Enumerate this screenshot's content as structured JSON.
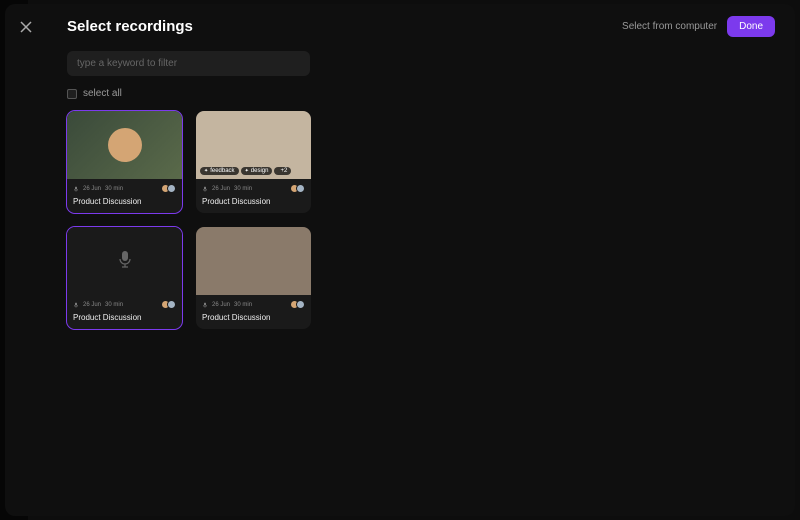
{
  "modal": {
    "title": "Select recordings",
    "select_from_computer": "Select from computer",
    "done": "Done",
    "search_placeholder": "type a keyword to filter",
    "select_all": "select all"
  },
  "recordings": [
    {
      "date": "26 Jun",
      "duration": "30 min",
      "title": "Product Discussion",
      "selected": true,
      "thumb_class": "t1",
      "tags": []
    },
    {
      "date": "26 Jun",
      "duration": "30 min",
      "title": "Product Discussion",
      "selected": false,
      "thumb_class": "t2",
      "tags": [
        "feedback",
        "design"
      ],
      "extra_tags": "+2"
    },
    {
      "date": "26 Jun",
      "duration": "30 min",
      "title": "Product Discussion",
      "selected": true,
      "thumb_class": "t3",
      "audio_only": true,
      "tags": []
    },
    {
      "date": "26 Jun",
      "duration": "30 min",
      "title": "Product Discussion",
      "selected": false,
      "thumb_class": "t4",
      "tags": []
    }
  ]
}
